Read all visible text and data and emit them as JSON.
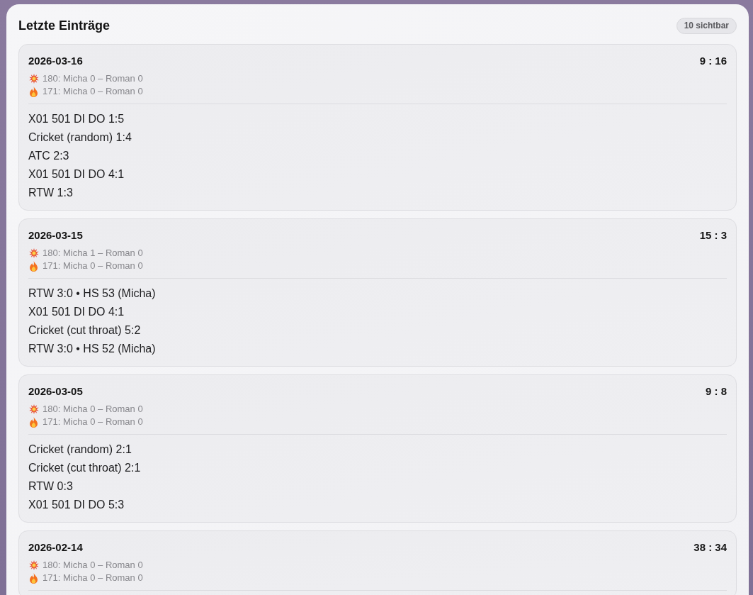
{
  "panel": {
    "title": "Letzte Einträge",
    "badge": "10 sichtbar"
  },
  "entries": [
    {
      "date": "2026-03-16",
      "score": "9 : 16",
      "stats": [
        "180: Micha 0 – Roman 0",
        "171: Micha 0 – Roman 0"
      ],
      "games": [
        "X01 501 DI DO 1:5",
        "Cricket (random) 1:4",
        "ATC 2:3",
        "X01 501 DI DO 4:1",
        "RTW 1:3"
      ]
    },
    {
      "date": "2026-03-15",
      "score": "15 : 3",
      "stats": [
        "180: Micha 1 – Roman 0",
        "171: Micha 0 – Roman 0"
      ],
      "games": [
        "RTW 3:0 • HS 53 (Micha)",
        "X01 501 DI DO 4:1",
        "Cricket (cut throat) 5:2",
        "RTW 3:0 • HS 52 (Micha)"
      ]
    },
    {
      "date": "2026-03-05",
      "score": "9 : 8",
      "stats": [
        "180: Micha 0 – Roman 0",
        "171: Micha 0 – Roman 0"
      ],
      "games": [
        "Cricket (random) 2:1",
        "Cricket (cut throat) 2:1",
        "RTW 0:3",
        "X01 501 DI DO 5:3"
      ]
    },
    {
      "date": "2026-02-14",
      "score": "38 : 34",
      "stats": [
        "180: Micha 0 – Roman 0",
        "171: Micha 0 – Roman 0"
      ]
    }
  ]
}
